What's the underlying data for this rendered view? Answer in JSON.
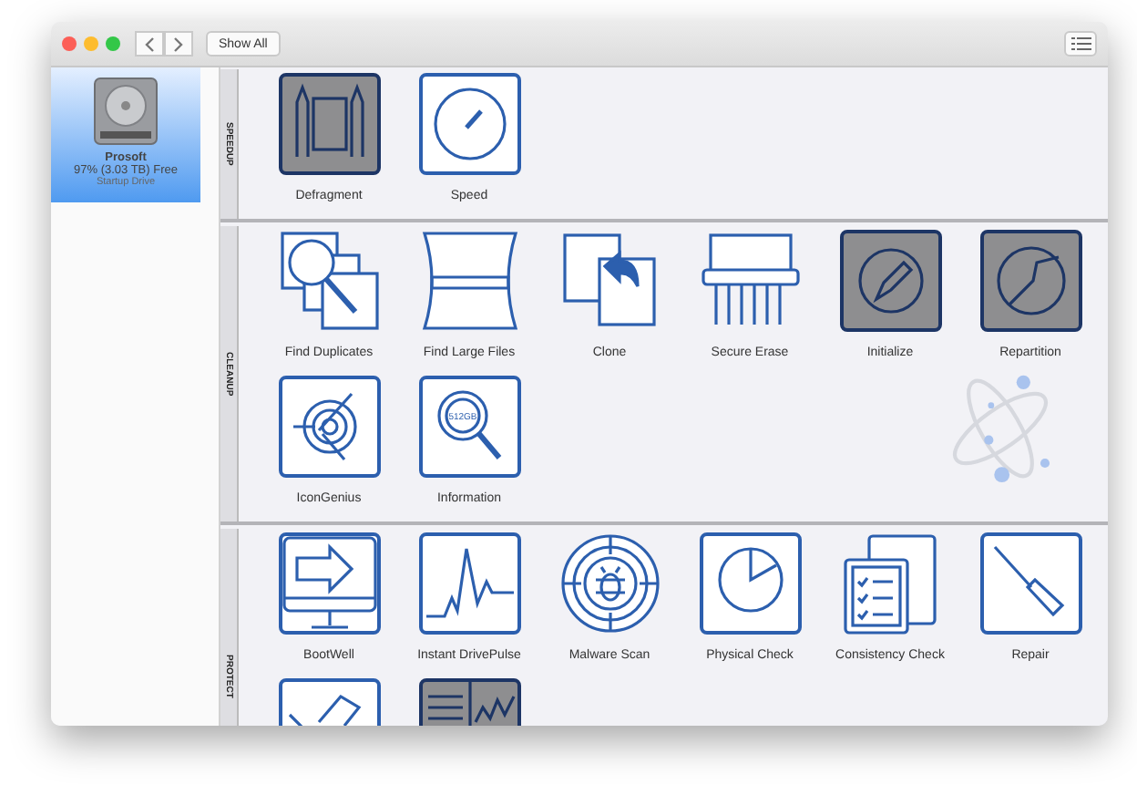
{
  "toolbar": {
    "show_all": "Show All"
  },
  "sidebar": {
    "items": [
      {
        "name": "Prosoft",
        "free": "97% (3.03 TB) Free",
        "role": "Startup Drive",
        "selected": true
      }
    ]
  },
  "sections": [
    {
      "label": "SPEEDUP",
      "tools": [
        {
          "kind": "defrag",
          "label": "Defragment",
          "disabled": true
        },
        {
          "kind": "speed",
          "label": "Speed",
          "disabled": false
        }
      ]
    },
    {
      "label": "CLEANUP",
      "tools": [
        {
          "kind": "duplicates",
          "label": "Find Duplicates",
          "disabled": false
        },
        {
          "kind": "largefiles",
          "label": "Find Large Files",
          "disabled": false
        },
        {
          "kind": "clone",
          "label": "Clone",
          "disabled": false
        },
        {
          "kind": "erase",
          "label": "Secure Erase",
          "disabled": false
        },
        {
          "kind": "initialize",
          "label": "Initialize",
          "disabled": true
        },
        {
          "kind": "repartition",
          "label": "Repartition",
          "disabled": true
        },
        {
          "kind": "icongenius",
          "label": "IconGenius",
          "disabled": false
        },
        {
          "kind": "information",
          "label": "Information",
          "icon_text": "512GB",
          "disabled": false
        }
      ]
    },
    {
      "label": "PROTECT",
      "tools": [
        {
          "kind": "bootwell",
          "label": "BootWell",
          "disabled": false
        },
        {
          "kind": "drivepulse",
          "label": "Instant DrivePulse",
          "disabled": false
        },
        {
          "kind": "malware",
          "label": "Malware Scan",
          "disabled": false
        },
        {
          "kind": "physical",
          "label": "Physical Check",
          "disabled": false
        },
        {
          "kind": "consistency",
          "label": "Consistency Check",
          "disabled": false
        },
        {
          "kind": "repair",
          "label": "Repair",
          "disabled": false
        },
        {
          "kind": "tools",
          "disabled": false
        },
        {
          "kind": "report",
          "disabled": true
        }
      ]
    }
  ]
}
